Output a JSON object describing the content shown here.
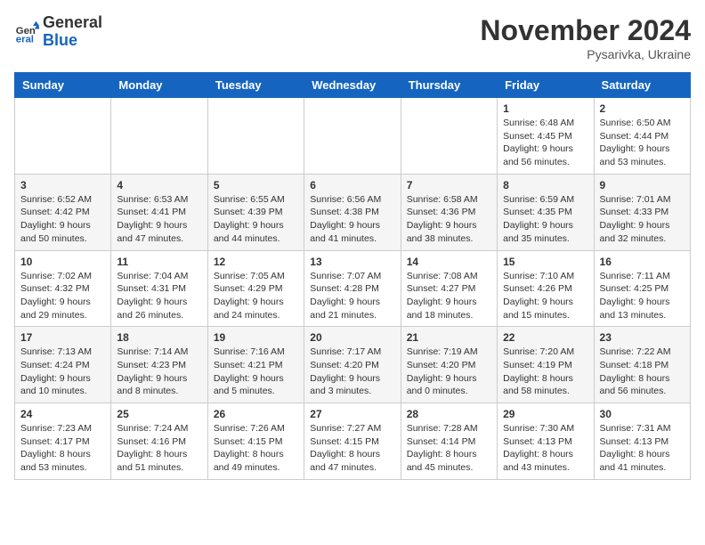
{
  "logo": {
    "general": "General",
    "blue": "Blue"
  },
  "title": "November 2024",
  "location": "Pysarivka, Ukraine",
  "days_of_week": [
    "Sunday",
    "Monday",
    "Tuesday",
    "Wednesday",
    "Thursday",
    "Friday",
    "Saturday"
  ],
  "weeks": [
    [
      {
        "day": "",
        "info": ""
      },
      {
        "day": "",
        "info": ""
      },
      {
        "day": "",
        "info": ""
      },
      {
        "day": "",
        "info": ""
      },
      {
        "day": "",
        "info": ""
      },
      {
        "day": "1",
        "info": "Sunrise: 6:48 AM\nSunset: 4:45 PM\nDaylight: 9 hours and 56 minutes."
      },
      {
        "day": "2",
        "info": "Sunrise: 6:50 AM\nSunset: 4:44 PM\nDaylight: 9 hours and 53 minutes."
      }
    ],
    [
      {
        "day": "3",
        "info": "Sunrise: 6:52 AM\nSunset: 4:42 PM\nDaylight: 9 hours and 50 minutes."
      },
      {
        "day": "4",
        "info": "Sunrise: 6:53 AM\nSunset: 4:41 PM\nDaylight: 9 hours and 47 minutes."
      },
      {
        "day": "5",
        "info": "Sunrise: 6:55 AM\nSunset: 4:39 PM\nDaylight: 9 hours and 44 minutes."
      },
      {
        "day": "6",
        "info": "Sunrise: 6:56 AM\nSunset: 4:38 PM\nDaylight: 9 hours and 41 minutes."
      },
      {
        "day": "7",
        "info": "Sunrise: 6:58 AM\nSunset: 4:36 PM\nDaylight: 9 hours and 38 minutes."
      },
      {
        "day": "8",
        "info": "Sunrise: 6:59 AM\nSunset: 4:35 PM\nDaylight: 9 hours and 35 minutes."
      },
      {
        "day": "9",
        "info": "Sunrise: 7:01 AM\nSunset: 4:33 PM\nDaylight: 9 hours and 32 minutes."
      }
    ],
    [
      {
        "day": "10",
        "info": "Sunrise: 7:02 AM\nSunset: 4:32 PM\nDaylight: 9 hours and 29 minutes."
      },
      {
        "day": "11",
        "info": "Sunrise: 7:04 AM\nSunset: 4:31 PM\nDaylight: 9 hours and 26 minutes."
      },
      {
        "day": "12",
        "info": "Sunrise: 7:05 AM\nSunset: 4:29 PM\nDaylight: 9 hours and 24 minutes."
      },
      {
        "day": "13",
        "info": "Sunrise: 7:07 AM\nSunset: 4:28 PM\nDaylight: 9 hours and 21 minutes."
      },
      {
        "day": "14",
        "info": "Sunrise: 7:08 AM\nSunset: 4:27 PM\nDaylight: 9 hours and 18 minutes."
      },
      {
        "day": "15",
        "info": "Sunrise: 7:10 AM\nSunset: 4:26 PM\nDaylight: 9 hours and 15 minutes."
      },
      {
        "day": "16",
        "info": "Sunrise: 7:11 AM\nSunset: 4:25 PM\nDaylight: 9 hours and 13 minutes."
      }
    ],
    [
      {
        "day": "17",
        "info": "Sunrise: 7:13 AM\nSunset: 4:24 PM\nDaylight: 9 hours and 10 minutes."
      },
      {
        "day": "18",
        "info": "Sunrise: 7:14 AM\nSunset: 4:23 PM\nDaylight: 9 hours and 8 minutes."
      },
      {
        "day": "19",
        "info": "Sunrise: 7:16 AM\nSunset: 4:21 PM\nDaylight: 9 hours and 5 minutes."
      },
      {
        "day": "20",
        "info": "Sunrise: 7:17 AM\nSunset: 4:20 PM\nDaylight: 9 hours and 3 minutes."
      },
      {
        "day": "21",
        "info": "Sunrise: 7:19 AM\nSunset: 4:20 PM\nDaylight: 9 hours and 0 minutes."
      },
      {
        "day": "22",
        "info": "Sunrise: 7:20 AM\nSunset: 4:19 PM\nDaylight: 8 hours and 58 minutes."
      },
      {
        "day": "23",
        "info": "Sunrise: 7:22 AM\nSunset: 4:18 PM\nDaylight: 8 hours and 56 minutes."
      }
    ],
    [
      {
        "day": "24",
        "info": "Sunrise: 7:23 AM\nSunset: 4:17 PM\nDaylight: 8 hours and 53 minutes."
      },
      {
        "day": "25",
        "info": "Sunrise: 7:24 AM\nSunset: 4:16 PM\nDaylight: 8 hours and 51 minutes."
      },
      {
        "day": "26",
        "info": "Sunrise: 7:26 AM\nSunset: 4:15 PM\nDaylight: 8 hours and 49 minutes."
      },
      {
        "day": "27",
        "info": "Sunrise: 7:27 AM\nSunset: 4:15 PM\nDaylight: 8 hours and 47 minutes."
      },
      {
        "day": "28",
        "info": "Sunrise: 7:28 AM\nSunset: 4:14 PM\nDaylight: 8 hours and 45 minutes."
      },
      {
        "day": "29",
        "info": "Sunrise: 7:30 AM\nSunset: 4:13 PM\nDaylight: 8 hours and 43 minutes."
      },
      {
        "day": "30",
        "info": "Sunrise: 7:31 AM\nSunset: 4:13 PM\nDaylight: 8 hours and 41 minutes."
      }
    ]
  ]
}
